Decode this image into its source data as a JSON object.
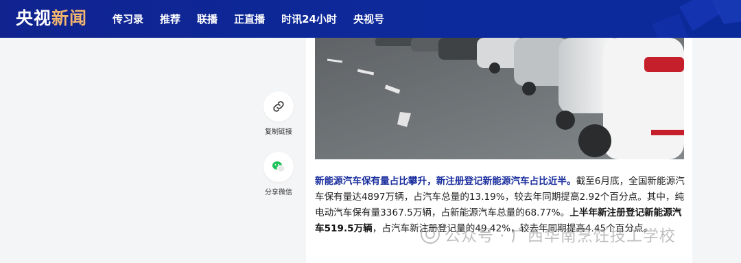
{
  "header": {
    "logo_main": "央视",
    "logo_accent": "新闻",
    "nav": [
      "传习录",
      "推荐",
      "联播",
      "正直播",
      "时讯24小时",
      "央视号"
    ]
  },
  "share": {
    "copy_link_label": "复制链接",
    "wechat_label": "分享微信"
  },
  "article": {
    "lead": "新能源汽车保有量占比攀升，新注册登记新能源汽车占比近半。",
    "text_1": "截至6月底，全国新能源汽车保有量达4897万辆，占汽车总量的13.19%，较去年同期提高2.92个百分点。其中，纯电动汽车保有量3367.5万辆，占新能源汽车总量的68.77%。",
    "bold_2": "上半年新注册登记新能源汽车519.5万辆",
    "text_3": "，占汽车新注册登记量的49.42%，较去年同期提高4.45个百分点。"
  },
  "watermark": {
    "text": "公众号 · 广西华南烹饪技工学校"
  },
  "colors": {
    "header_bg": "#10238f",
    "logo_accent": "#f2b56d",
    "lead_text": "#1b2f9e",
    "page_bg": "#f4f5f7"
  }
}
